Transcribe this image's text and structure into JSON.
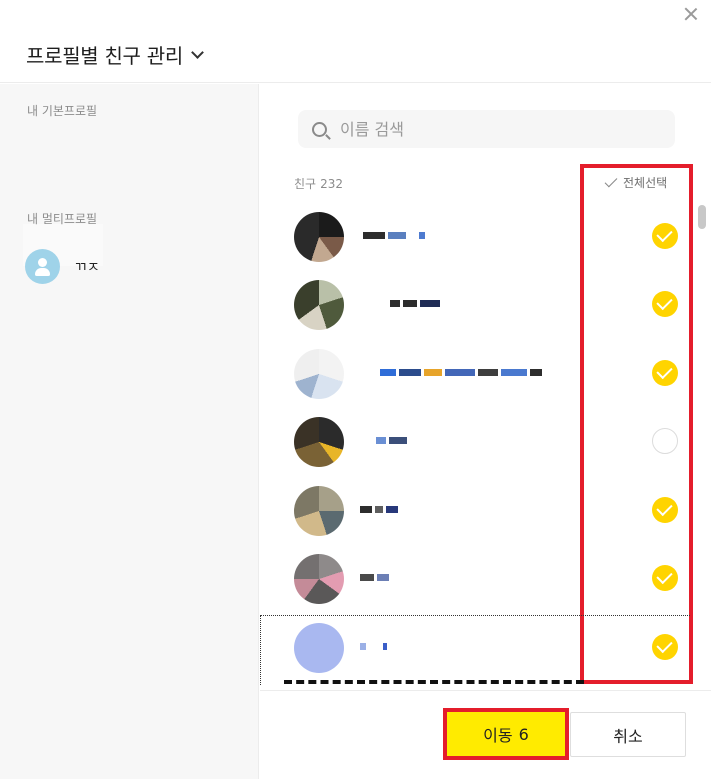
{
  "header": {
    "title": "프로필별 친구 관리",
    "close_icon": "close-icon",
    "dropdown_icon": "chevron-down-icon"
  },
  "sidebar": {
    "basic_section_label": "내 기본프로필",
    "multi_section_label": "내 멀티프로필",
    "multi_profile": {
      "name": "ㄲㅈ",
      "avatar_color": "#9fd3e9"
    }
  },
  "search": {
    "placeholder": "이름 검색"
  },
  "friends": {
    "label": "친구",
    "count": "232",
    "select_all_label": "전체선택",
    "items": [
      {
        "checked": true
      },
      {
        "checked": true
      },
      {
        "checked": true
      },
      {
        "checked": false
      },
      {
        "checked": true
      },
      {
        "checked": true
      },
      {
        "checked": true
      }
    ]
  },
  "footer": {
    "move_label": "이동",
    "move_count": "6",
    "cancel_label": "취소"
  },
  "colors": {
    "accent_yellow": "#ffd400",
    "button_yellow": "#ffeb00",
    "highlight_red": "#e41d2b"
  }
}
